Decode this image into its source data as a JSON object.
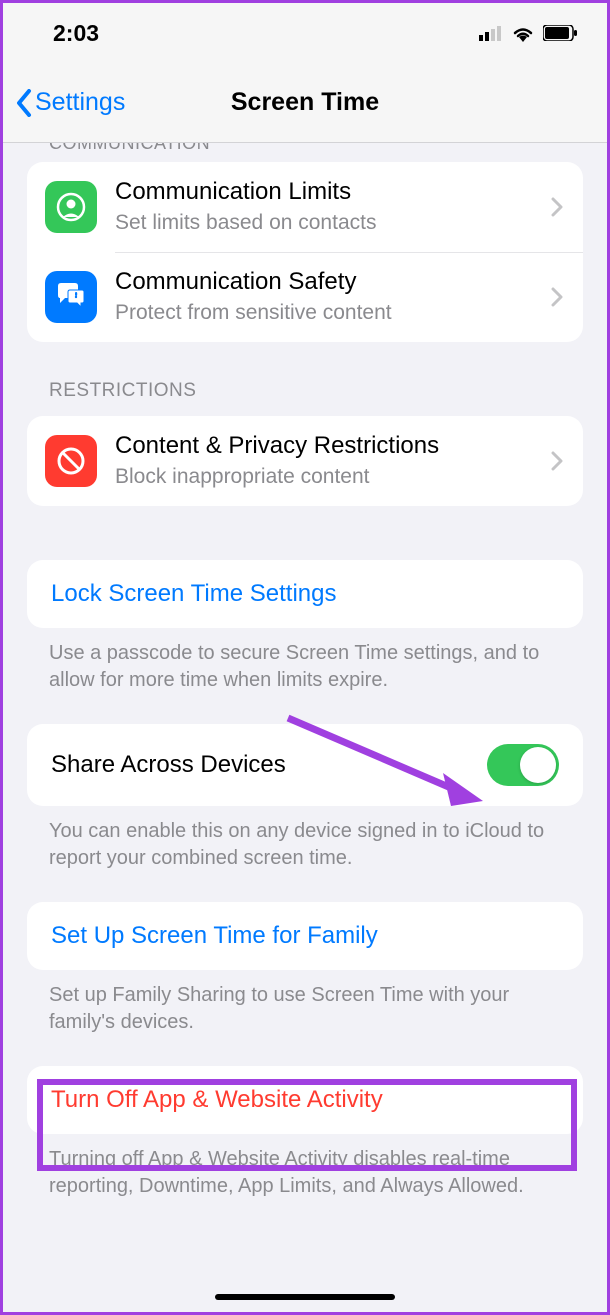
{
  "statusBar": {
    "time": "2:03"
  },
  "nav": {
    "back": "Settings",
    "title": "Screen Time"
  },
  "partialHeader": "COMMUNICATION",
  "commGroup": [
    {
      "title": "Communication Limits",
      "sub": "Set limits based on contacts"
    },
    {
      "title": "Communication Safety",
      "sub": "Protect from sensitive content"
    }
  ],
  "restrictionHeader": "RESTRICTIONS",
  "restrictionRow": {
    "title": "Content & Privacy Restrictions",
    "sub": "Block inappropriate content"
  },
  "lock": {
    "label": "Lock Screen Time Settings",
    "footer": "Use a passcode to secure Screen Time settings, and to allow for more time when limits expire."
  },
  "share": {
    "label": "Share Across Devices",
    "enabled": true,
    "footer": "You can enable this on any device signed in to iCloud to report your combined screen time."
  },
  "family": {
    "label": "Set Up Screen Time for Family",
    "footer": "Set up Family Sharing to use Screen Time with your family's devices."
  },
  "turnOff": {
    "label": "Turn Off App & Website Activity",
    "footer": "Turning off App & Website Activity disables real-time reporting, Downtime, App Limits, and Always Allowed."
  },
  "colors": {
    "accent": "#007aff",
    "destructive": "#ff3b30",
    "annotation": "#a040e0"
  }
}
